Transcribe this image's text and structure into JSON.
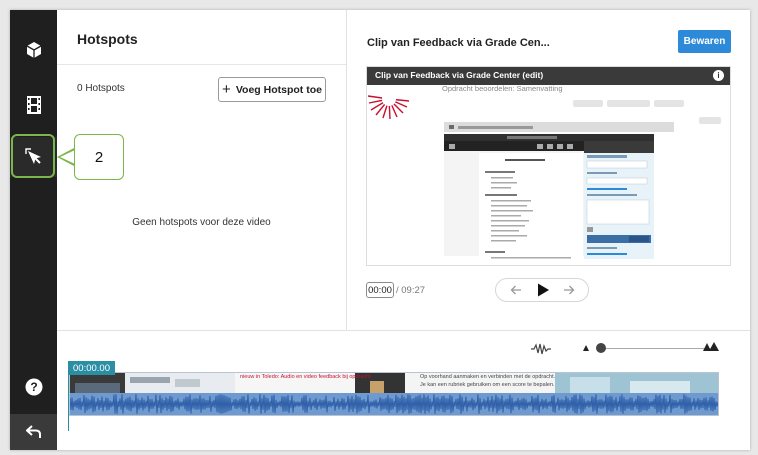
{
  "sidebar": {
    "items": [
      {
        "icon": "cube-icon",
        "active": false
      },
      {
        "icon": "film-strip-icon",
        "active": false
      },
      {
        "icon": "hotspot-cursor-icon",
        "active": true
      }
    ],
    "help_icon": "help-icon",
    "back_icon": "back-arrow-icon"
  },
  "callout": {
    "label": "2"
  },
  "hotspots": {
    "title": "Hotspots",
    "count_label": "0 Hotspots",
    "add_button": "Voeg Hotspot toe",
    "empty_message": "Geen hotspots voor deze video"
  },
  "video": {
    "title": "Clip van Feedback via Grade Cen...",
    "save_button": "Bewaren",
    "player_title": "Clip van Feedback via Grade Center (edit)",
    "slide_subtitle": "Opdracht beoordelen: Samenvatting",
    "current_time": "00:00",
    "total_time": "/ 09:27"
  },
  "timeline": {
    "playhead_time": "00:00.00",
    "clip_texts": [
      "nieuw in Toledo: Audio en video feedback bij opdracht",
      "Op voorhand aanmaken en verbinden met de opdracht.",
      "Je kan een rubriek gebruiken om een score te bepalen."
    ]
  },
  "colors": {
    "accent": "#2d8ad8",
    "highlight": "#7ab648",
    "sidebar": "#1f1f1f",
    "waveform": "#2f5fa8",
    "playhead": "#2b8fa3"
  }
}
